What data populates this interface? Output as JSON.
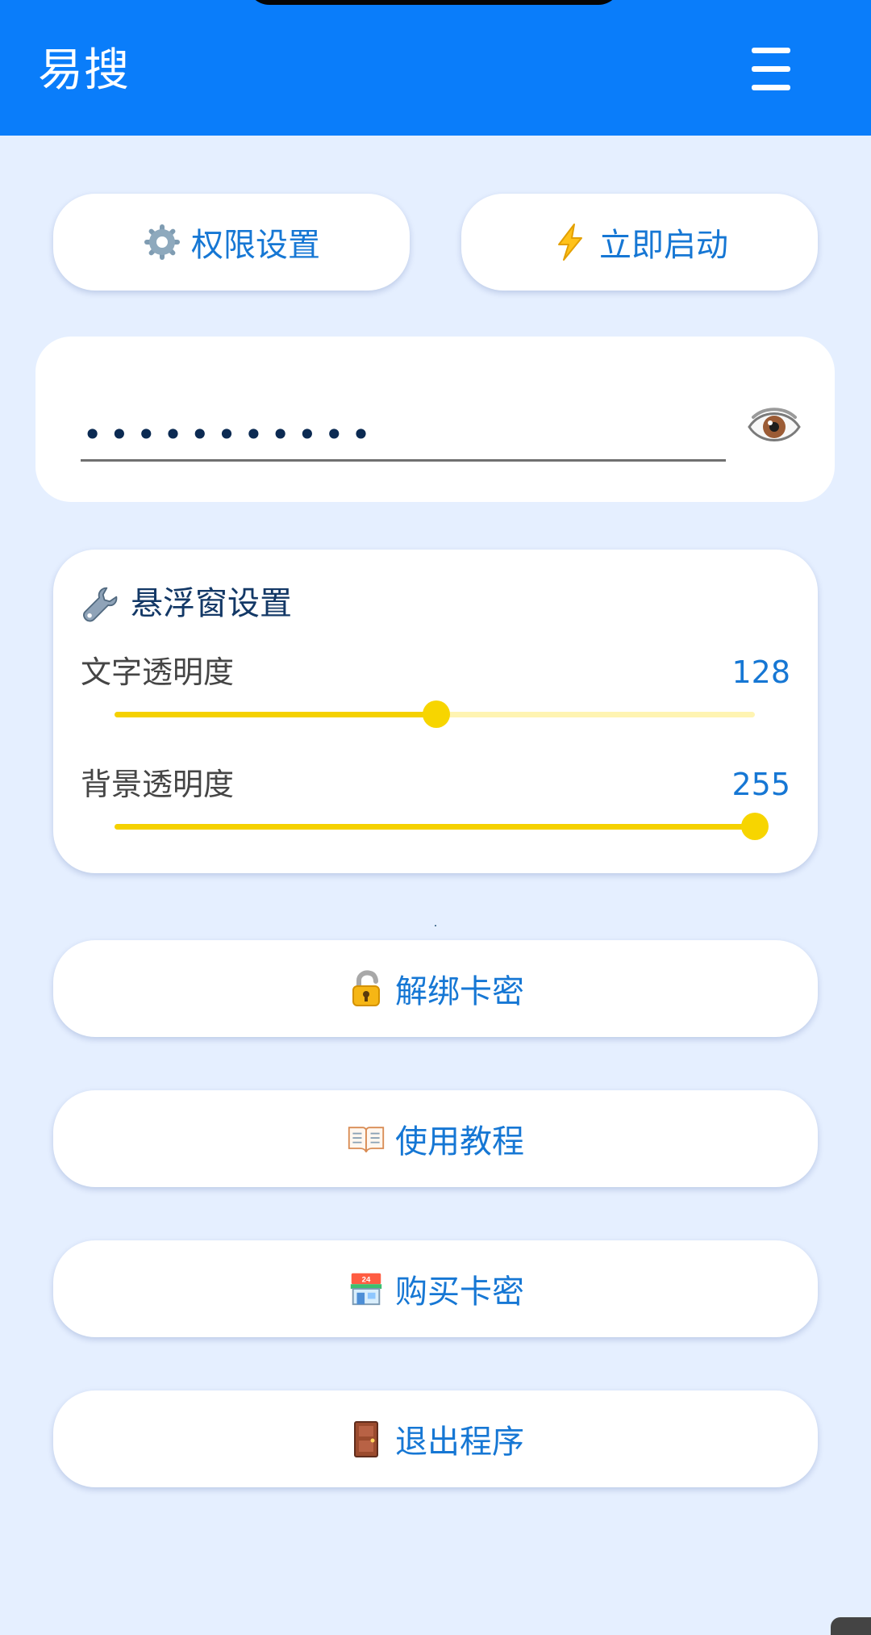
{
  "app": {
    "title": "易搜",
    "menu_icon": "menu-icon"
  },
  "actions": {
    "permission_label": "权限设置",
    "permission_icon": "gear-icon",
    "start_label": "立即启动",
    "start_icon": "lightning-icon"
  },
  "password": {
    "value": "•••••••••••",
    "eye_icon": "eye-icon"
  },
  "float_settings": {
    "title": "悬浮窗设置",
    "title_icon": "wrench-icon",
    "text_opacity": {
      "label": "文字透明度",
      "value": "128",
      "fraction": 0.502
    },
    "background_opacity": {
      "label": "背景透明度",
      "value": "255",
      "fraction": 1.0
    }
  },
  "menu": {
    "unbind_label": "解绑卡密",
    "unbind_icon": "unlock-icon",
    "tutorial_label": "使用教程",
    "tutorial_icon": "book-icon",
    "buy_label": "购买卡密",
    "buy_icon": "store-icon",
    "exit_label": "退出程序",
    "exit_icon": "door-icon"
  },
  "colors": {
    "app_bar": "#0a7dfa",
    "background": "#e5efff",
    "accent_text": "#1677d4",
    "slider": "#f5d100"
  }
}
